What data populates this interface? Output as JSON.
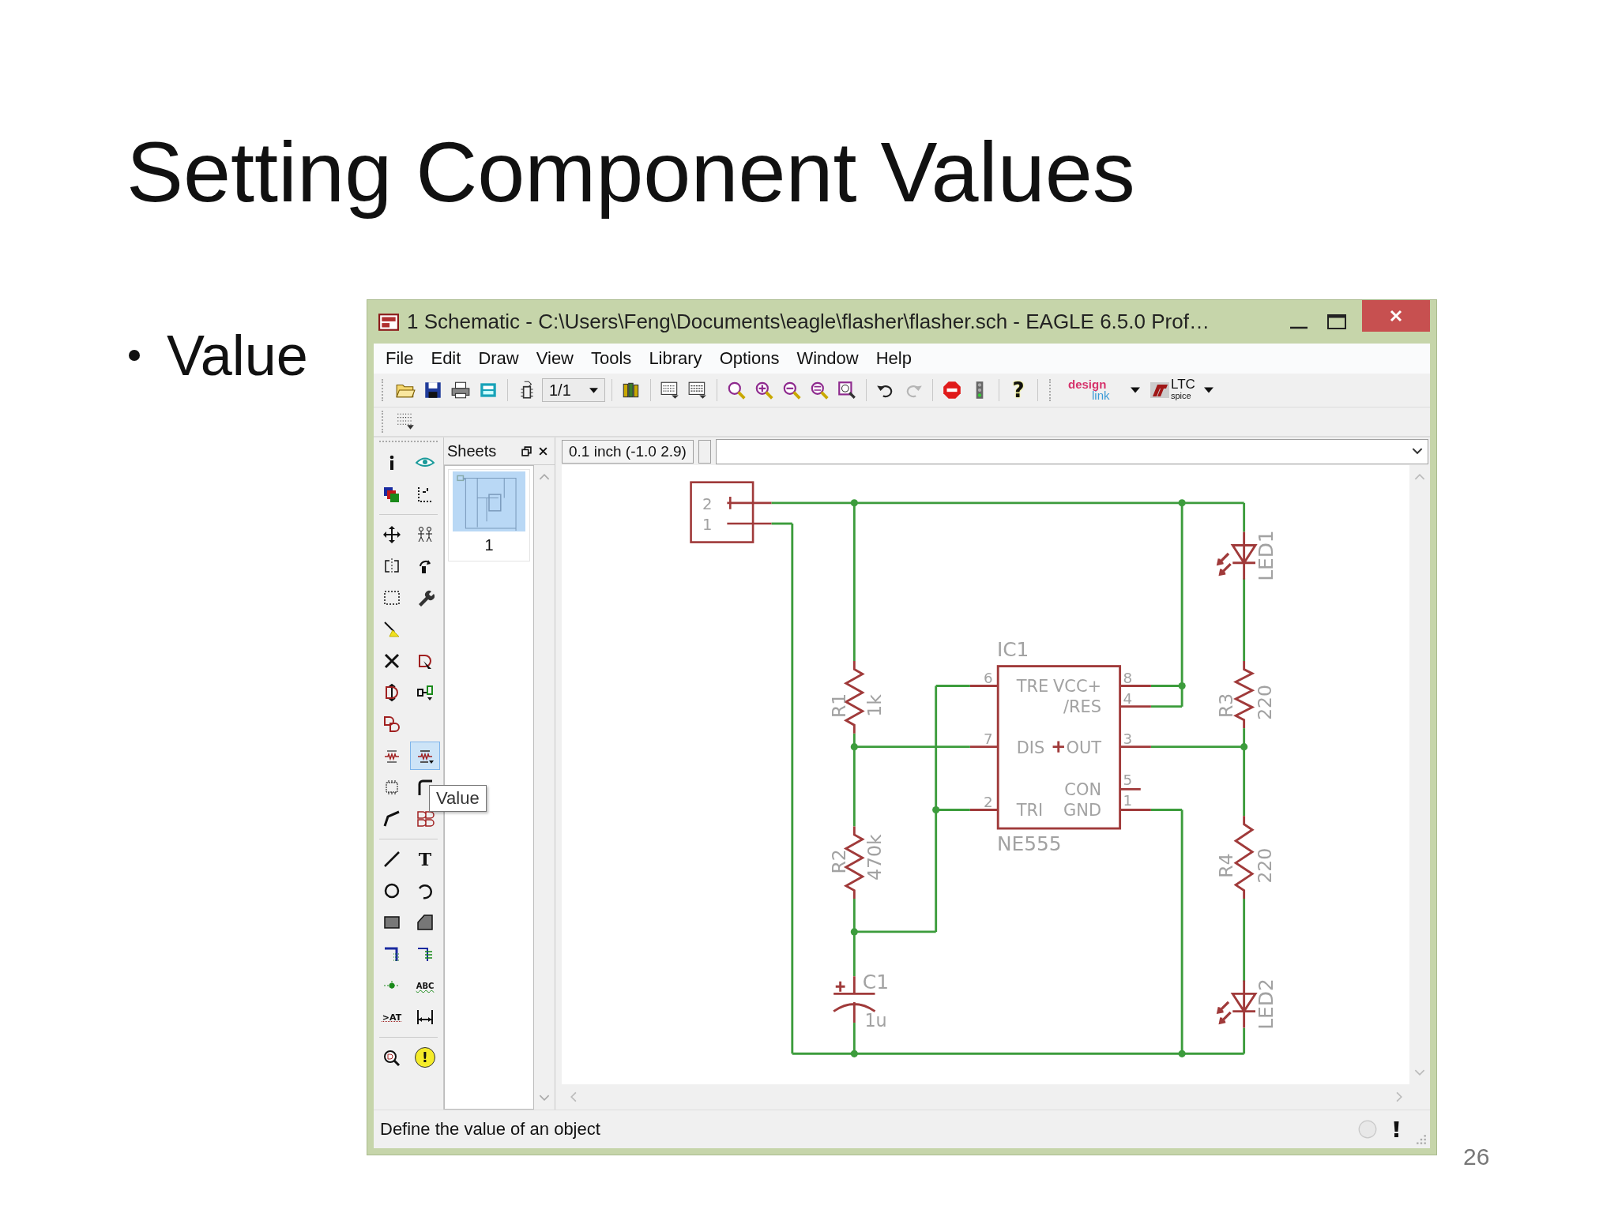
{
  "slide": {
    "title": "Setting Component Values",
    "bullets": [
      "Value"
    ],
    "page_number": "26"
  },
  "window": {
    "title": "1 Schematic - C:\\Users\\Feng\\Documents\\eagle\\flasher\\flasher.sch - EAGLE 6.5.0 Prof…"
  },
  "menu": [
    "File",
    "Edit",
    "Draw",
    "View",
    "Tools",
    "Library",
    "Options",
    "Window",
    "Help"
  ],
  "toolbar": [
    [
      {
        "kind": "open"
      },
      {
        "kind": "save"
      },
      {
        "kind": "print"
      },
      {
        "kind": "cam"
      }
    ],
    [
      {
        "kind": "board"
      },
      {
        "kind": "select",
        "value": "1/1"
      }
    ],
    [
      {
        "kind": "library"
      }
    ],
    [
      {
        "kind": "script"
      },
      {
        "kind": "ulp"
      }
    ],
    [
      {
        "kind": "zoom-fit"
      },
      {
        "kind": "zoom-in"
      },
      {
        "kind": "zoom-out"
      },
      {
        "kind": "zoom-select"
      },
      {
        "kind": "redraw"
      }
    ],
    [
      {
        "kind": "undo",
        "disabled": false
      },
      {
        "kind": "redo",
        "disabled": true
      }
    ],
    [
      {
        "kind": "stop"
      },
      {
        "kind": "drc"
      }
    ],
    [
      {
        "kind": "help",
        "glyph": "?"
      }
    ]
  ],
  "toolbar_logos": [
    {
      "kind": "designlink",
      "top": "design",
      "bottom": "link"
    },
    {
      "kind": "ltspice",
      "top": "LTC",
      "bottom": "spice"
    }
  ],
  "toolbar2": [
    {
      "kind": "grid"
    }
  ],
  "tools": [
    [
      [
        {
          "kind": "info",
          "selected": false
        },
        {
          "kind": "show",
          "selected": false
        }
      ],
      [
        {
          "kind": "layers",
          "selected": false
        },
        {
          "kind": "mark",
          "selected": false
        }
      ]
    ],
    [
      [
        {
          "kind": "move",
          "selected": false
        },
        {
          "kind": "copy",
          "selected": false
        }
      ],
      [
        {
          "kind": "mirror",
          "selected": false
        },
        {
          "kind": "rotate",
          "selected": false
        }
      ],
      [
        {
          "kind": "group",
          "selected": false
        },
        {
          "kind": "change",
          "selected": false
        }
      ],
      [
        {
          "kind": "paste",
          "selected": false
        }
      ],
      [
        {
          "kind": "delete",
          "selected": false
        },
        {
          "kind": "add",
          "selected": false
        }
      ],
      [
        {
          "kind": "pinswap",
          "selected": false
        },
        {
          "kind": "replace",
          "selected": false
        }
      ],
      [
        {
          "kind": "invoke",
          "selected": false
        }
      ],
      [
        {
          "kind": "name",
          "selected": false
        },
        {
          "kind": "value",
          "selected": true
        }
      ],
      [
        {
          "kind": "smash",
          "selected": false
        },
        {
          "kind": "miter",
          "selected": false
        }
      ],
      [
        {
          "kind": "split",
          "selected": false
        },
        {
          "kind": "gateswap",
          "selected": false
        }
      ]
    ],
    [
      [
        {
          "kind": "wire",
          "selected": false
        },
        {
          "kind": "text",
          "selected": false,
          "glyph": "T"
        }
      ],
      [
        {
          "kind": "circle",
          "selected": false
        },
        {
          "kind": "arc",
          "selected": false
        }
      ],
      [
        {
          "kind": "rect",
          "selected": false
        },
        {
          "kind": "polygon",
          "selected": false
        }
      ],
      [
        {
          "kind": "bus",
          "selected": false
        },
        {
          "kind": "net",
          "selected": false
        }
      ],
      [
        {
          "kind": "junction",
          "selected": false
        },
        {
          "kind": "label",
          "selected": false,
          "glyph": "ABC"
        }
      ],
      [
        {
          "kind": "attribute",
          "selected": false,
          "glyph": ">AT"
        },
        {
          "kind": "dimension",
          "selected": false
        }
      ]
    ],
    [
      [
        {
          "kind": "erc",
          "selected": false
        },
        {
          "kind": "errors",
          "selected": false,
          "glyph": "!"
        }
      ]
    ]
  ],
  "tooltip": "Value",
  "sheets": {
    "title": "Sheets",
    "items": [
      {
        "label": "1",
        "selected": true
      }
    ]
  },
  "coordinates": "0.1 inch (-1.0 2.9)",
  "schematic": {
    "labels": [
      "2",
      "1",
      "R1",
      "1k",
      "R2",
      "470k",
      "C1",
      "1u",
      "IC1",
      "NE555",
      "6",
      "7",
      "2",
      "8",
      "4",
      "3",
      "5",
      "1",
      "TRE",
      "VCC+",
      "/RES",
      "DIS",
      "OUT",
      "CON",
      "TRI",
      "GND",
      "LED1",
      "R3",
      "220",
      "R4",
      "220",
      "LED2"
    ]
  },
  "status_bar": {
    "message": "Define the value of an object"
  }
}
